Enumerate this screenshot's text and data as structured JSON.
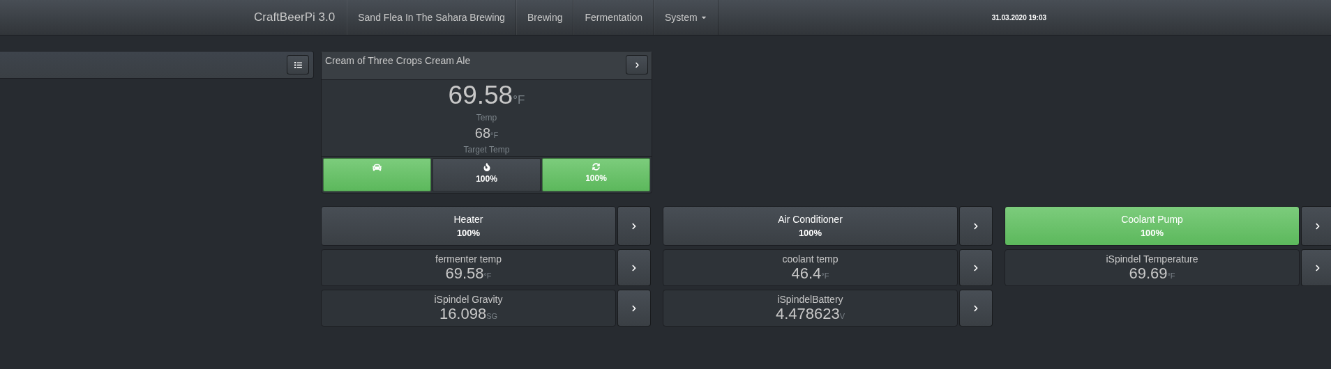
{
  "navbar": {
    "brand": "CraftBeerPi 3.0",
    "items": [
      {
        "label": "Sand Flea In The Sahara Brewing",
        "dropdown": false
      },
      {
        "label": "Brewing",
        "dropdown": false
      },
      {
        "label": "Fermentation",
        "dropdown": false
      },
      {
        "label": "System",
        "dropdown": true
      }
    ],
    "datetime": "31.03.2020 19:03"
  },
  "fermenter": {
    "name": "Cream of Three Crops Cream Ale",
    "temp": "69.58",
    "temp_unit": "°F",
    "temp_label": "Temp",
    "target": "68",
    "target_unit": "°F",
    "target_label": "Target Temp",
    "controls": [
      {
        "kind": "car",
        "on": true
      },
      {
        "kind": "fire",
        "on": false,
        "reading": "100%"
      },
      {
        "kind": "refresh",
        "on": true,
        "reading": "100%"
      }
    ]
  },
  "columns": [
    {
      "actor": {
        "name": "Heater",
        "reading": "100%",
        "on": false
      },
      "sensors": [
        {
          "name": "fermenter temp",
          "value": "69.58",
          "unit": "°F"
        },
        {
          "name": "iSpindel Gravity",
          "value": "16.098",
          "unit": "SG"
        }
      ]
    },
    {
      "actor": {
        "name": "Air Conditioner",
        "reading": "100%",
        "on": false
      },
      "sensors": [
        {
          "name": "coolant temp",
          "value": "46.4",
          "unit": "°F"
        },
        {
          "name": "iSpindelBattery",
          "value": "4.478623",
          "unit": "V"
        }
      ]
    },
    {
      "actor": {
        "name": "Coolant Pump",
        "reading": "100%",
        "on": true
      },
      "sensors": [
        {
          "name": "iSpindel Temperature",
          "value": "69.69",
          "unit": "°F"
        }
      ]
    }
  ]
}
